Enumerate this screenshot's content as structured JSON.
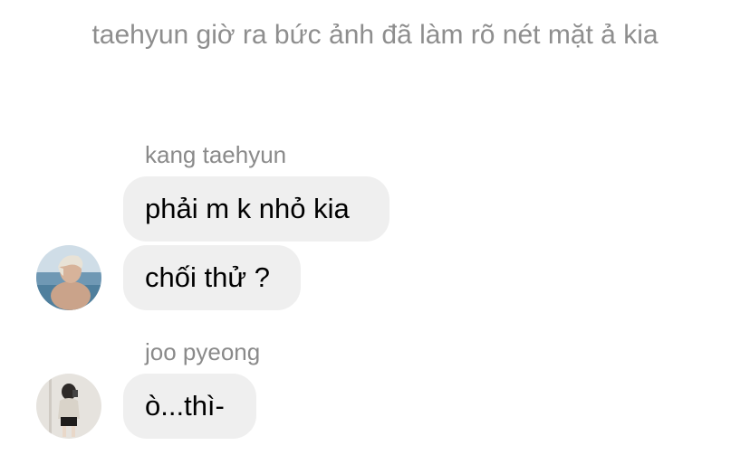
{
  "system_note": {
    "text": "taehyun giờ ra bức ảnh đã làm rõ nét mặt ả kia"
  },
  "messages": [
    {
      "sender": "kang taehyun",
      "bubbles": [
        "phải m k nhỏ kia",
        "chối thử ?"
      ],
      "avatar_icon": "user-photo-beach"
    },
    {
      "sender": "joo pyeong",
      "bubbles": [
        "ò...thì-"
      ],
      "avatar_icon": "user-photo-mirror"
    }
  ],
  "colors": {
    "bubble_bg": "#efefef",
    "meta_text": "#8e8e8e",
    "message_text": "#000000"
  }
}
